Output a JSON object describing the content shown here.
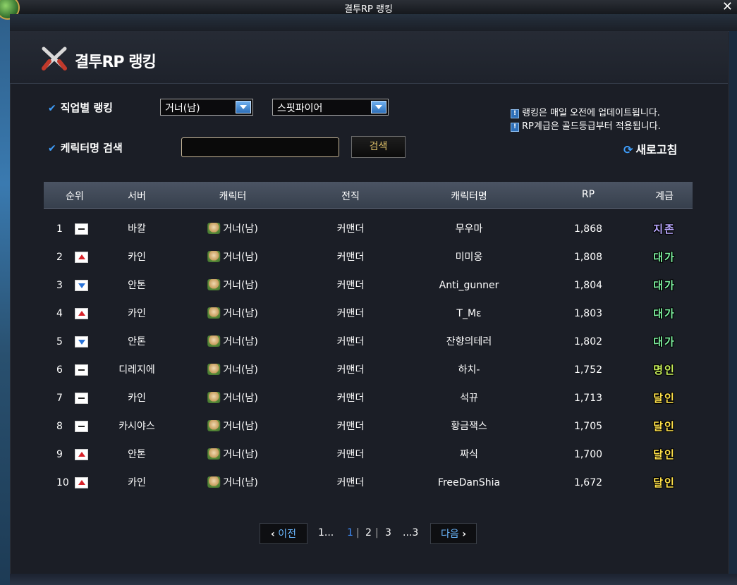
{
  "window": {
    "title": "결투RP 랭킹",
    "close": "✕"
  },
  "header": {
    "title": "결투RP 랭킹"
  },
  "filters": {
    "job_label": "직업별 랭킹",
    "job_value": "거너(남)",
    "advance_value": "스핏파이어",
    "name_label": "케릭터명 검색",
    "name_value": "",
    "search_button": "검색"
  },
  "notices": [
    "랭킹은 매일 오전에 업데이트됩니다.",
    "RP계급은 골드등급부터 적용됩니다."
  ],
  "refresh_label": "새로고침",
  "table": {
    "headers": [
      "순위",
      "서버",
      "캐릭터",
      "전직",
      "캐릭터명",
      "RP",
      "계급"
    ],
    "rows": [
      {
        "rank": "1",
        "change": "same",
        "server": "바칼",
        "character": "거너(남)",
        "advance": "커맨더",
        "name": "무우마",
        "rp": "1,868",
        "grade": "지존",
        "grade_color": "#b9a8ff"
      },
      {
        "rank": "2",
        "change": "up",
        "server": "카인",
        "character": "거너(남)",
        "advance": "커맨더",
        "name": "미미옹",
        "rp": "1,808",
        "grade": "대가",
        "grade_color": "#7df0a0"
      },
      {
        "rank": "3",
        "change": "down",
        "server": "안톤",
        "character": "거너(남)",
        "advance": "커맨더",
        "name": "Anti_gunner",
        "rp": "1,804",
        "grade": "대가",
        "grade_color": "#7df0a0"
      },
      {
        "rank": "4",
        "change": "up",
        "server": "카인",
        "character": "거너(남)",
        "advance": "커맨더",
        "name": "T_Mε",
        "rp": "1,803",
        "grade": "대가",
        "grade_color": "#7df0a0"
      },
      {
        "rank": "5",
        "change": "down",
        "server": "안톤",
        "character": "거너(남)",
        "advance": "커맨더",
        "name": "잔향의테러",
        "rp": "1,802",
        "grade": "대가",
        "grade_color": "#7df0a0"
      },
      {
        "rank": "6",
        "change": "same",
        "server": "디레지에",
        "character": "거너(남)",
        "advance": "커맨더",
        "name": "하치-",
        "rp": "1,752",
        "grade": "명인",
        "grade_color": "#c8f05a"
      },
      {
        "rank": "7",
        "change": "same",
        "server": "카인",
        "character": "거너(남)",
        "advance": "커맨더",
        "name": "석뀨",
        "rp": "1,713",
        "grade": "달인",
        "grade_color": "#ffe14a"
      },
      {
        "rank": "8",
        "change": "same",
        "server": "카시야스",
        "character": "거너(남)",
        "advance": "커맨더",
        "name": "황금잭스",
        "rp": "1,705",
        "grade": "달인",
        "grade_color": "#ffe14a"
      },
      {
        "rank": "9",
        "change": "up",
        "server": "안톤",
        "character": "거너(남)",
        "advance": "커맨더",
        "name": "짜식",
        "rp": "1,700",
        "grade": "달인",
        "grade_color": "#ffe14a"
      },
      {
        "rank": "10",
        "change": "up",
        "server": "카인",
        "character": "거너(남)",
        "advance": "커맨더",
        "name": "FreeDanShia",
        "rp": "1,672",
        "grade": "달인",
        "grade_color": "#ffe14a"
      }
    ]
  },
  "pagination": {
    "prev": "이전",
    "first": "1...",
    "pages": [
      "1",
      "2",
      "3"
    ],
    "current": "1",
    "last": "...3",
    "next": "다음"
  }
}
